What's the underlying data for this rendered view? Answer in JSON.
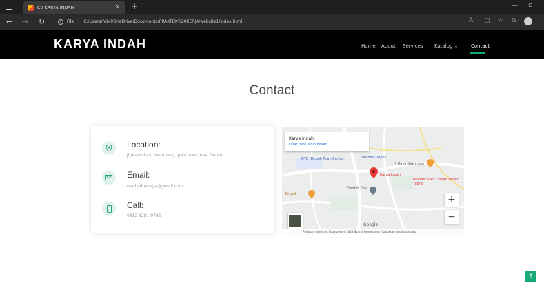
{
  "browser": {
    "tab_title": "CV KARYA INDAH",
    "tab_close": "×",
    "new_tab": "+",
    "url_scheme": "File",
    "url_path": "C:/Users/febri/OneDrive/Documents/PRAKTEK%20KERJA/website1/index.html"
  },
  "header": {
    "brand": "KARYA INDAH",
    "nav": [
      {
        "label": "Home"
      },
      {
        "label": "About"
      },
      {
        "label": "Services"
      },
      {
        "label": "Katalog ⌄"
      },
      {
        "label": "Contact",
        "active": true
      }
    ]
  },
  "main": {
    "title": "Contact",
    "contact": {
      "location": {
        "label": "Location:",
        "value": "jl pramuka II mampang, pancoran mas, Depok"
      },
      "email": {
        "label": "Email:",
        "value": "madiadnansya@gmail.com"
      },
      "call": {
        "label": "Call:",
        "value": "0812 8281 9785"
      }
    },
    "map": {
      "place_name": "Karya Indah",
      "larger_map_link": "Lihat peta lebih besar",
      "labels": [
        "DTC (Depok Town Center)",
        "Pesona Depok",
        "Jl. Raya Sawangan",
        "Karya Indah",
        "Rumah Sakit Umum Bhakti Yudha",
        "Pondok Mas",
        "Tanpak",
        "Google"
      ],
      "attribution": "Pintasan keyboard   Data peta ©2022   Syarat Penggunaan   Laporkan kesalahan peta",
      "zoom_in": "+",
      "zoom_out": "−"
    }
  },
  "back_to_top": "↑",
  "colors": {
    "accent": "#18a97a",
    "header_bg": "#000000",
    "icon_bg": "#dff3ec",
    "pin": "#e53935"
  }
}
